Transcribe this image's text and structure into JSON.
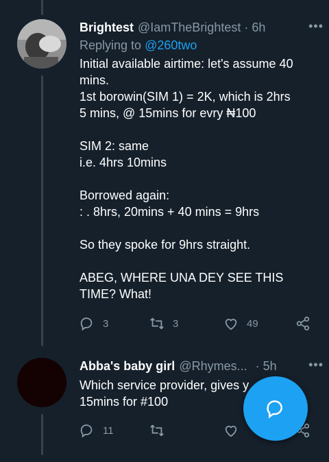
{
  "tweets": [
    {
      "name": "Brightest",
      "handle": "@IamTheBrightest",
      "time": "6h",
      "reply_prefix": "Replying to",
      "reply_to": "@260two",
      "lines": [
        "Initial available airtime: let's assume 40",
        "mins.",
        "1st borowin(SIM 1) = 2K, which is 2hrs",
        "5 mins, @ 15mins for evry ₦100",
        "",
        "SIM 2: same",
        "i.e. 4hrs 10mins",
        "",
        "Borrowed again:",
        ": . 8hrs, 20mins + 40 mins = 9hrs",
        "",
        "So they spoke for 9hrs straight.",
        "",
        "ABEG, WHERE UNA DEY SEE THIS",
        "TIME? What!"
      ],
      "replies": "3",
      "retweets": "3",
      "likes": "49"
    },
    {
      "name": "Abba's baby girl",
      "handle": "@Rhymes...",
      "time": "5h",
      "lines": [
        "Which service provider, gives y",
        "15mins for #100"
      ],
      "replies": "11",
      "retweets": "",
      "likes": ""
    }
  ],
  "more_icon": "•••",
  "dot": "·",
  "fab_icon": "compose-reply-icon",
  "colors": {
    "background": "#15202b",
    "accent": "#1da1f2",
    "muted": "#8899a6"
  }
}
